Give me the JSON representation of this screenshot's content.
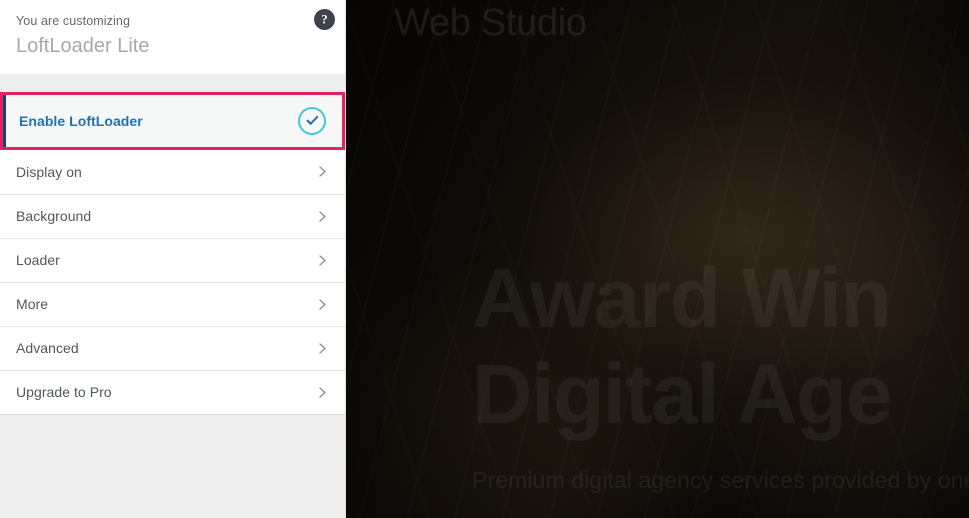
{
  "sidebar": {
    "header": {
      "eyebrow": "You are customizing",
      "title": "LoftLoader Lite",
      "help_icon": "help-circle-icon",
      "help_glyph": "?"
    },
    "enable_section": {
      "label": "Enable LoftLoader",
      "toggle_icon": "check-circle-icon",
      "toggle_state": "on",
      "highlight_color": "#e0245e",
      "accent_color": "#1d3f72",
      "label_color": "#2271b1",
      "toggle_ring_color": "#42c6d6",
      "toggle_check_color": "#2c6fb5"
    },
    "menu_items": [
      {
        "label": "Display on",
        "chevron_icon": "chevron-right-icon"
      },
      {
        "label": "Background",
        "chevron_icon": "chevron-right-icon"
      },
      {
        "label": "Loader",
        "chevron_icon": "chevron-right-icon"
      },
      {
        "label": "More",
        "chevron_icon": "chevron-right-icon"
      },
      {
        "label": "Advanced",
        "chevron_icon": "chevron-right-icon"
      },
      {
        "label": "Upgrade to Pro",
        "chevron_icon": "chevron-right-icon"
      }
    ]
  },
  "preview": {
    "site_logo": "Web Studio",
    "hero_line_1": "Award Win",
    "hero_line_2": "Digital Age",
    "hero_subtitle": "Premium digital agency services provided by one o",
    "background": "#0a0806"
  }
}
